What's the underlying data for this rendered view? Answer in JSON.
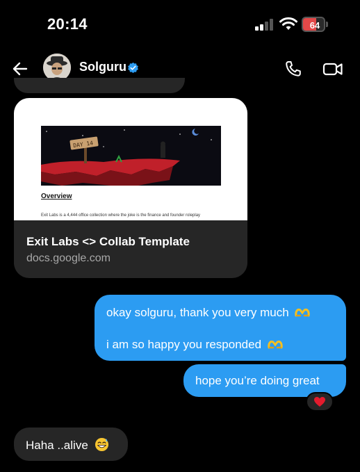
{
  "status_bar": {
    "time": "20:14",
    "battery_percent": "64",
    "battery_level": 0.64,
    "battery_color": "#e24848"
  },
  "header": {
    "back_icon": "arrow-left-icon",
    "username": "Solguru",
    "verified_icon": "verified-badge-icon",
    "verified_color": "#2c9cf2",
    "call_icon": "phone-icon",
    "video_icon": "video-camera-icon"
  },
  "link_card": {
    "preview": {
      "banner_text": "DAY 14",
      "heading": "Overview",
      "body": "Exit Labs is a 4,444 office collection where the joke is the finance and founder roleplay"
    },
    "title": "Exit Labs <> Collab Template",
    "domain": "docs.google.com"
  },
  "messages": {
    "sent_1": {
      "line_1": "okay solguru, thank you very much",
      "line_2": "i am so happy you responded",
      "emoji": "heart-hands-emoji"
    },
    "sent_2": {
      "text": "hope you’re doing great",
      "reaction": "❤️"
    },
    "received_1": {
      "text": "Haha ..alive",
      "emoji": "grinning-sweat-emoji"
    }
  },
  "colors": {
    "background": "#000000",
    "sent_bubble": "#2c9cf2",
    "received_bubble": "#262626"
  }
}
